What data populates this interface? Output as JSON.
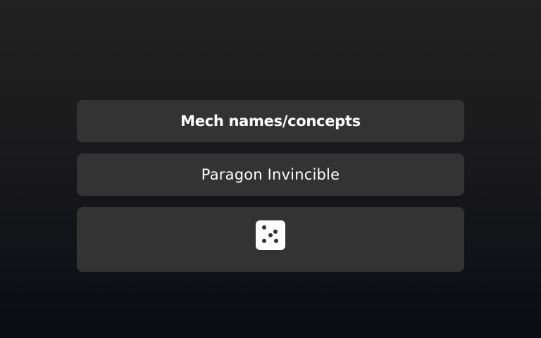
{
  "generator": {
    "title": "Mech names/concepts",
    "result": "Paragon Invincible",
    "roll_button": {
      "icon": "dice-five-icon"
    }
  },
  "colors": {
    "panel": "#333333",
    "text": "#ffffff"
  }
}
